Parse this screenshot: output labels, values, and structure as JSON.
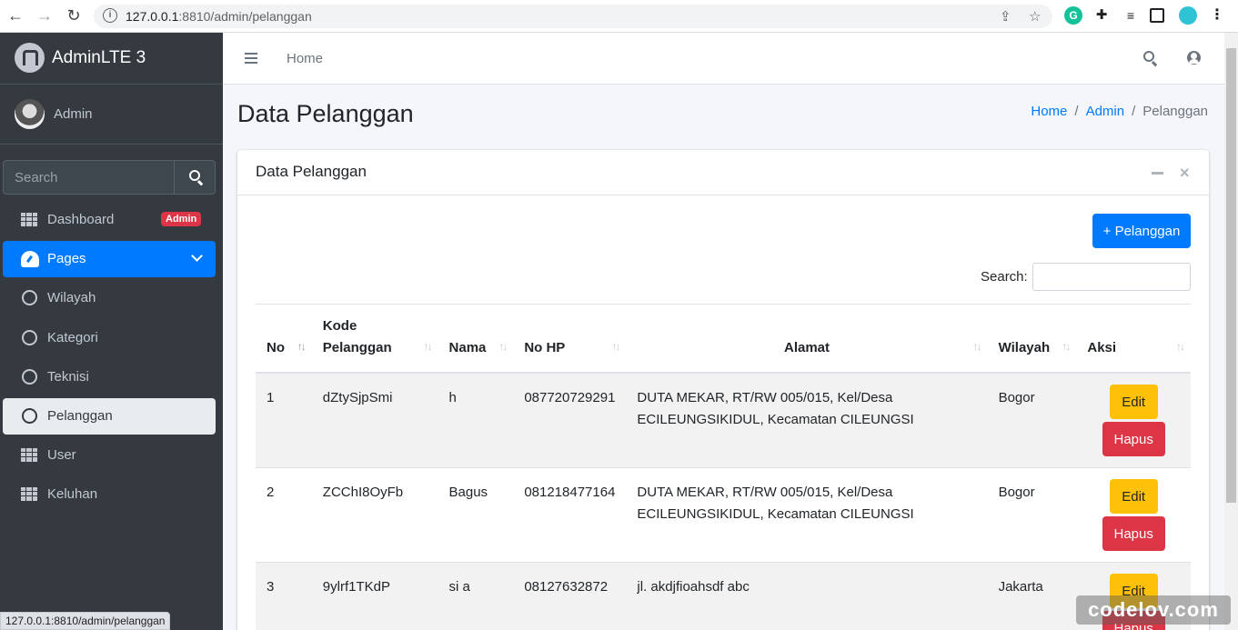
{
  "browser": {
    "url_host": "127.0.0.1",
    "url_path": ":8810/admin/pelanggan"
  },
  "status_url": "127.0.0.1:8810/admin/pelanggan",
  "sidebar": {
    "brand": "AdminLTE 3",
    "user": "Admin",
    "search_placeholder": "Search",
    "items": [
      {
        "label": "Dashboard",
        "icon": "grid-icon",
        "badge": "Admin"
      },
      {
        "label": "Pages",
        "icon": "gauge-icon",
        "active": true
      },
      {
        "label": "Wilayah",
        "icon": "circle-icon"
      },
      {
        "label": "Kategori",
        "icon": "circle-icon"
      },
      {
        "label": "Teknisi",
        "icon": "circle-icon"
      },
      {
        "label": "Pelanggan",
        "icon": "circle-icon",
        "selected": true
      },
      {
        "label": "User",
        "icon": "grid-icon"
      },
      {
        "label": "Keluhan",
        "icon": "grid-icon"
      }
    ]
  },
  "topnav": {
    "home": "Home"
  },
  "page": {
    "title": "Data Pelanggan",
    "breadcrumb": [
      "Home",
      "Admin",
      "Pelanggan"
    ]
  },
  "card": {
    "title": "Data Pelanggan",
    "add_button": "+ Pelanggan",
    "search_label": "Search:"
  },
  "table": {
    "headers": [
      "No",
      "Kode Pelanggan",
      "Nama",
      "No HP",
      "Alamat",
      "Wilayah",
      "Aksi"
    ],
    "rows": [
      {
        "no": "1",
        "kode": "dZtySjpSmi",
        "nama": "h",
        "hp": "087720729291",
        "alamat": "DUTA MEKAR, RT/RW 005/015, Kel/Desa ECILEUNGSIKIDUL, Kecamatan CILEUNGSI",
        "wilayah": "Bogor"
      },
      {
        "no": "2",
        "kode": "ZCChI8OyFb",
        "nama": "Bagus",
        "hp": "081218477164",
        "alamat": "DUTA MEKAR, RT/RW 005/015, Kel/Desa ECILEUNGSIKIDUL, Kecamatan CILEUNGSI",
        "wilayah": "Bogor"
      },
      {
        "no": "3",
        "kode": "9ylrf1TKdP",
        "nama": "si a",
        "hp": "08127632872",
        "alamat": "jl. akdjfioahsdf abc",
        "wilayah": "Jakarta"
      }
    ],
    "edit_label": "Edit",
    "delete_label": "Hapus"
  },
  "watermark": "codelov.com",
  "colors": {
    "primary": "#007bff",
    "sidebar": "#343a40",
    "warning": "#ffc107",
    "danger": "#dc3545"
  }
}
